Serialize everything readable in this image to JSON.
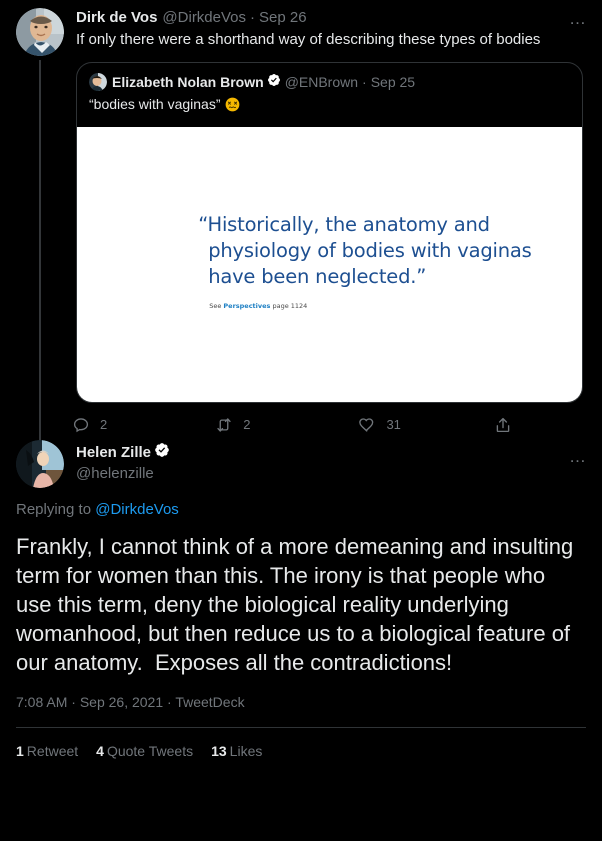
{
  "parent_tweet": {
    "display_name": "Dirk de Vos",
    "handle": "@DirkdeVos",
    "separator": "·",
    "date": "Sep 26",
    "text": "If only there were a shorthand way of describing these types of bodies",
    "more_icon": "…",
    "avatar_alt": "dirk-de-vos-avatar"
  },
  "quoted_tweet": {
    "display_name": "Elizabeth Nolan Brown",
    "handle": "@ENBrown",
    "separator": "·",
    "date": "Sep 25",
    "text": "“bodies with vaginas”",
    "emoji_name": "face-with-crossed-out-eyes-emoji",
    "verified": true,
    "image": {
      "quote_lines": [
        "“Historically, the anatomy and",
        "physiology of bodies with vaginas",
        "have been neglected.”"
      ],
      "credit_prefix": "See ",
      "credit_link": "Perspectives",
      "credit_suffix": " page 1124",
      "text_color": "#1d4f91",
      "background_color": "#ffffff"
    }
  },
  "quoted_actions": {
    "reply": {
      "icon": "reply-icon",
      "count": "2"
    },
    "retweet": {
      "icon": "retweet-icon",
      "count": "2"
    },
    "like": {
      "icon": "heart-icon",
      "count": "31"
    },
    "share": {
      "icon": "share-icon",
      "count": ""
    }
  },
  "main_tweet": {
    "display_name": "Helen Zille",
    "handle": "@helenzille",
    "verified": true,
    "more_icon": "…",
    "replying_label": "Replying to ",
    "replying_to": "@DirkdeVos",
    "text": "Frankly, I cannot think of a more demeaning and insulting term for women than this. The irony is that people who use this term, deny the biological reality underlying womanhood, but then reduce us to a biological feature of our anatomy.  Exposes all the contradictions!",
    "time": "7:08 AM",
    "date": "Sep 26, 2021",
    "source": "TweetDeck",
    "meta_separator": "·",
    "avatar_alt": "helen-zille-avatar"
  },
  "main_stats": [
    {
      "count": "1",
      "label": "Retweet"
    },
    {
      "count": "4",
      "label": "Quote Tweets"
    },
    {
      "count": "13",
      "label": "Likes"
    }
  ],
  "colors": {
    "background": "#000000",
    "text": "#e7e9ea",
    "muted": "#71767b",
    "link": "#1d9bf0",
    "border": "#2f3336",
    "thread_line": "#333639"
  }
}
